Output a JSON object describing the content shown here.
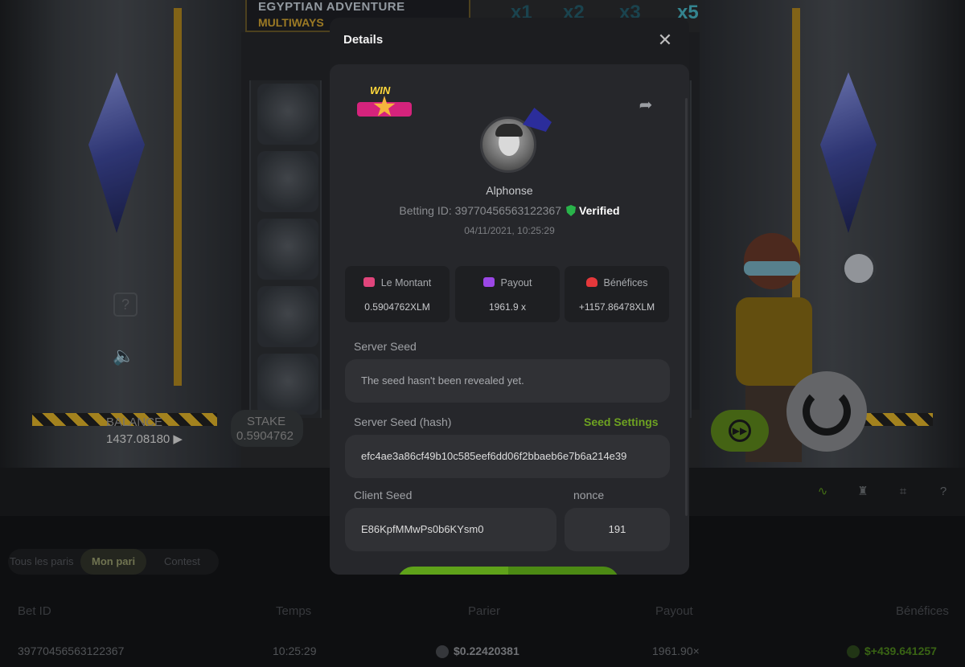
{
  "game": {
    "logo_line1": "EGYPTIAN ADVENTURE",
    "logo_line2": "MULTIWAYS",
    "multipliers": [
      "x1",
      "x2",
      "x3",
      "x5"
    ],
    "balance_label": "BALANCE",
    "balance_value": "1437.08180 ▶",
    "stake_label": "STAKE",
    "stake_value": "0.5904762",
    "help_glyph": "?",
    "sound_glyph": "🔈",
    "ff_glyph": "▶▶",
    "icons": [
      "help-icon",
      "sound-icon",
      "fast-forward-icon",
      "spin-icon"
    ]
  },
  "toolbar": {
    "icons": [
      "chart-line-icon",
      "trophy-icon",
      "fullscreen-icon",
      "help-circle-icon"
    ],
    "glyphs": [
      "∿",
      "♜",
      "⌗",
      "?"
    ]
  },
  "tabs": {
    "all": "Tous les paris",
    "mine": "Mon pari",
    "contest": "Contest"
  },
  "bets_table": {
    "headers": [
      "Bet ID",
      "Temps",
      "Parier",
      "Payout",
      "Bénéfices"
    ],
    "row": {
      "bet_id": "39770456563122367",
      "time": "10:25:29",
      "amount": "$0.22420381",
      "payout": "1961.90×",
      "profit": "$+439.641257"
    }
  },
  "modal": {
    "title": "Details",
    "close_glyph": "✕",
    "win_badge": "WIN",
    "share_glyph": "➦",
    "username": "Alphonse",
    "betting_id_label": "Betting ID:",
    "betting_id": "39770456563122367",
    "verified": "Verified",
    "datetime": "04/11/2021, 10:25:29",
    "stats": [
      {
        "label": "Le Montant",
        "value": "0.5904762XLM",
        "icon": "coins-icon",
        "color": "#e0457b"
      },
      {
        "label": "Payout",
        "value": "1961.9 x",
        "icon": "wallet-icon",
        "color": "#9b47e6"
      },
      {
        "label": "Bénéfices",
        "value": "+1157.86478XLM",
        "icon": "profit-hand-icon",
        "color": "#e5383b"
      }
    ],
    "server_seed_label": "Server Seed",
    "server_seed_value": "The seed hasn't been revealed yet.",
    "server_seed_hash_label": "Server Seed (hash)",
    "seed_settings": "Seed Settings",
    "server_seed_hash_value": "efc4ae3a86cf49b10c585eef6dd06f2bbaeb6e7b6a214e39",
    "client_seed_label": "Client Seed",
    "client_seed_value": "E86KpfMMwPs0b6KYsm0",
    "nonce_label": "nonce",
    "nonce_value": "191"
  },
  "colors": {
    "accent_green": "#6ea221",
    "modal_bg": "#1c1d20",
    "card_bg": "#26272b",
    "verified_shield": "#29b34a"
  }
}
